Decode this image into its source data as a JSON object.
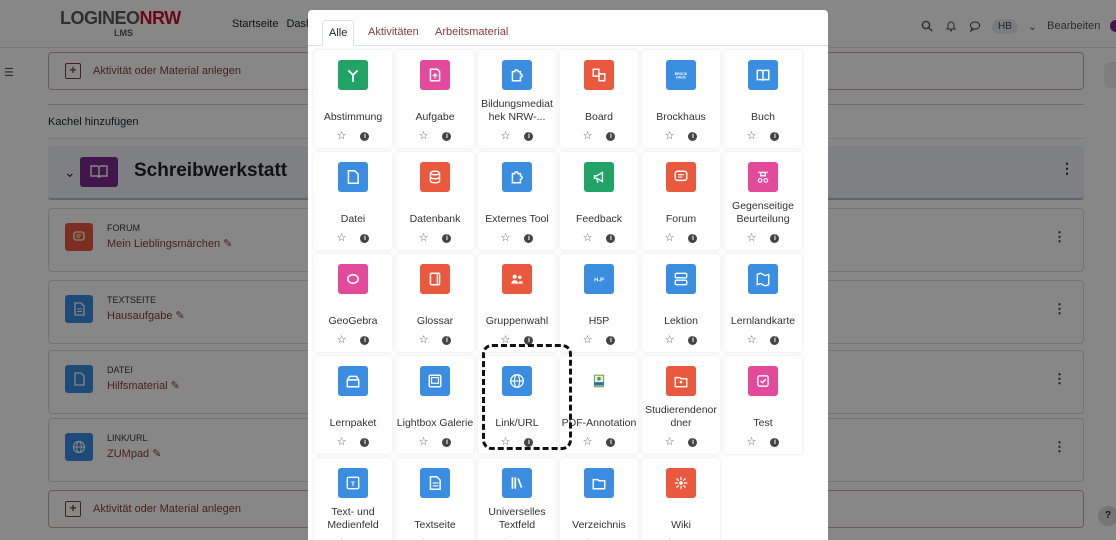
{
  "header": {
    "logo_main": "LOGINEO",
    "logo_accent": "NRW",
    "logo_sub": "LMS",
    "nav": [
      "Startseite",
      "Dashb"
    ],
    "user_initials": "HB",
    "edit_label": "Bearbeiten"
  },
  "course": {
    "add_activity_label": "Aktivität oder Material anlegen",
    "add_tile_label": "Kachel hinzufügen",
    "section_title": "Schreibwerkstatt",
    "items": [
      {
        "type": "FORUM",
        "name": "Mein Lieblingsmärchen",
        "color": "#e8593d",
        "icon": "forum-icon"
      },
      {
        "type": "TEXTSEITE",
        "name": "Hausaufgabe",
        "color": "#3a8de0",
        "icon": "page-icon"
      },
      {
        "type": "DATEI",
        "name": "Hilfsmaterial",
        "color": "#3a8de0",
        "icon": "file-icon"
      },
      {
        "type": "LINK/URL",
        "name": "ZUMpad",
        "color": "#3a8de0",
        "icon": "globe-icon"
      }
    ],
    "help_label": "?"
  },
  "modal": {
    "tabs": [
      "Alle",
      "Aktivitäten",
      "Arbeitsmaterial"
    ],
    "active_tab": "Alle",
    "star_glyph": "☆",
    "info_glyph": "i",
    "tiles": [
      {
        "name": "Abstimmung",
        "color": "#21a366",
        "icon": "choice-icon"
      },
      {
        "name": "Aufgabe",
        "color": "#e44a9c",
        "icon": "assignment-icon"
      },
      {
        "name": "Bildungsmediat\nhek NRW-...",
        "color": "#3a8de0",
        "icon": "puzzle-icon"
      },
      {
        "name": "Board",
        "color": "#e8593d",
        "icon": "board-icon"
      },
      {
        "name": "Brockhaus",
        "color": "#3a8de0",
        "icon": "brockhaus-icon"
      },
      {
        "name": "Buch",
        "color": "#3a8de0",
        "icon": "book-icon"
      },
      {
        "name": "Datei",
        "color": "#3a8de0",
        "icon": "file-icon"
      },
      {
        "name": "Datenbank",
        "color": "#e8593d",
        "icon": "database-icon"
      },
      {
        "name": "Externes Tool",
        "color": "#3a8de0",
        "icon": "puzzle-icon"
      },
      {
        "name": "Feedback",
        "color": "#21a366",
        "icon": "megaphone-icon"
      },
      {
        "name": "Forum",
        "color": "#e8593d",
        "icon": "forum-icon"
      },
      {
        "name": "Gegenseitige\nBeurteilung",
        "color": "#e44a9c",
        "icon": "workshop-icon"
      },
      {
        "name": "GeoGebra",
        "color": "#e44a9c",
        "icon": "geogebra-icon"
      },
      {
        "name": "Glossar",
        "color": "#e8593d",
        "icon": "glossary-icon"
      },
      {
        "name": "Gruppenwahl",
        "color": "#e8593d",
        "icon": "group-icon"
      },
      {
        "name": "H5P",
        "color": "#3a8de0",
        "icon": "h5p-icon"
      },
      {
        "name": "Lektion",
        "color": "#3a8de0",
        "icon": "lesson-icon"
      },
      {
        "name": "Lernlandkarte",
        "color": "#3a8de0",
        "icon": "map-icon"
      },
      {
        "name": "Lernpaket",
        "color": "#3a8de0",
        "icon": "package-icon"
      },
      {
        "name": "Lightbox Galerie",
        "color": "#3a8de0",
        "icon": "gallery-icon"
      },
      {
        "name": "Link/URL",
        "color": "#3a8de0",
        "icon": "globe-icon"
      },
      {
        "name": "PDF-Annotation",
        "color": "#ffffff",
        "icon": "pdf-icon"
      },
      {
        "name": "Studierendenor\ndner",
        "color": "#e8593d",
        "icon": "folder-users-icon"
      },
      {
        "name": "Test",
        "color": "#e44a9c",
        "icon": "quiz-icon"
      },
      {
        "name": "Text- und\nMedienfeld",
        "color": "#3a8de0",
        "icon": "textmedia-icon"
      },
      {
        "name": "Textseite",
        "color": "#3a8de0",
        "icon": "page-icon"
      },
      {
        "name": "Universelles\nTextfeld",
        "color": "#3a8de0",
        "icon": "books-icon"
      },
      {
        "name": "Verzeichnis",
        "color": "#3a8de0",
        "icon": "folder-icon"
      },
      {
        "name": "Wiki",
        "color": "#e8593d",
        "icon": "wiki-icon"
      }
    ]
  }
}
